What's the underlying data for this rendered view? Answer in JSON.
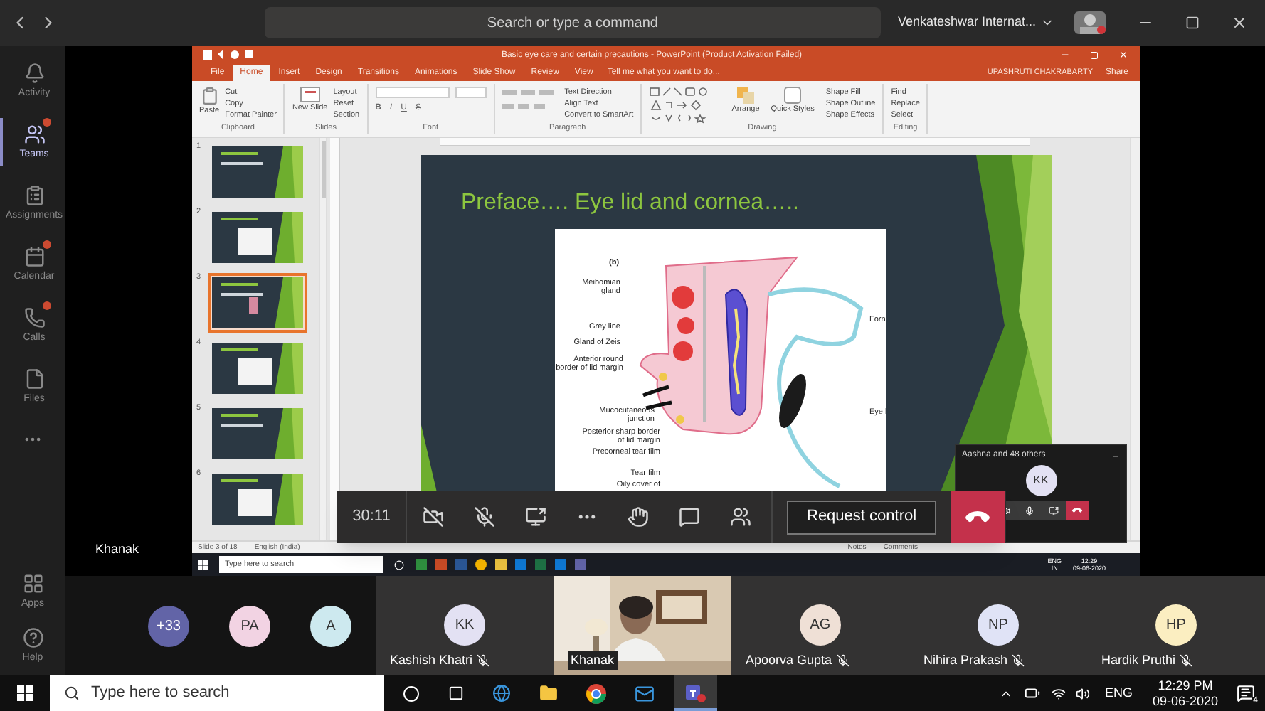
{
  "title_bar": {
    "search": {
      "placeholder": "Search or type a command"
    },
    "org": "Venkateshwar Internat..."
  },
  "app_bar": {
    "items": [
      {
        "kind": "activity",
        "label": "Activity",
        "selected": false,
        "dot": false
      },
      {
        "kind": "teams",
        "label": "Teams",
        "selected": true,
        "dot": true
      },
      {
        "kind": "assignments",
        "label": "Assignments",
        "selected": false,
        "dot": false
      },
      {
        "kind": "calendar",
        "label": "Calendar",
        "selected": false,
        "dot": true
      },
      {
        "kind": "calls",
        "label": "Calls",
        "selected": false,
        "dot": true
      },
      {
        "kind": "files",
        "label": "Files",
        "selected": false,
        "dot": false
      }
    ],
    "bottom": [
      {
        "kind": "apps",
        "label": "Apps"
      },
      {
        "kind": "help",
        "label": "Help"
      }
    ]
  },
  "shared_screen": {
    "title": "Basic eye care and certain precautions - PowerPoint (Product Activation Failed)",
    "tabs": [
      {
        "label": "File",
        "selected": false
      },
      {
        "label": "Home",
        "selected": true
      },
      {
        "label": "Insert",
        "selected": false
      },
      {
        "label": "Design",
        "selected": false
      },
      {
        "label": "Transitions",
        "selected": false
      },
      {
        "label": "Animations",
        "selected": false
      },
      {
        "label": "Slide Show",
        "selected": false
      },
      {
        "label": "Review",
        "selected": false
      },
      {
        "label": "View",
        "selected": false
      }
    ],
    "tell_me": "Tell me what you want to do...",
    "user": "UPASHRUTI CHAKRABARTY",
    "share": "Share",
    "ribbon_groups": [
      {
        "kind": "clipboard",
        "label": "Clipboard",
        "items": [
          "Paste",
          "Cut",
          "Copy",
          "Format Painter"
        ]
      },
      {
        "kind": "slides",
        "label": "Slides",
        "items": [
          "New Slide",
          "Layout",
          "Reset",
          "Section"
        ]
      },
      {
        "kind": "font",
        "label": "Font",
        "items": [
          "B",
          "I",
          "U",
          "S"
        ]
      },
      {
        "kind": "paragraph",
        "label": "Paragraph",
        "items": [
          "Text Direction",
          "Align Text",
          "Convert to SmartArt"
        ]
      },
      {
        "kind": "drawing",
        "label": "Drawing",
        "items": [
          "Arrange",
          "Quick Styles",
          "Shape Fill",
          "Shape Outline",
          "Shape Effects"
        ]
      },
      {
        "kind": "editing",
        "label": "Editing",
        "items": [
          "Find",
          "Replace",
          "Select"
        ]
      }
    ],
    "thumbnails": [
      {
        "number": "1",
        "selected": false
      },
      {
        "number": "2",
        "selected": false
      },
      {
        "number": "3",
        "selected": true
      },
      {
        "number": "4",
        "selected": false
      },
      {
        "number": "5",
        "selected": false
      },
      {
        "number": "6",
        "selected": false
      }
    ],
    "slide": {
      "title": "Preface…. Eye lid and cornea…..",
      "figure_labels": [
        {
          "text": "(b)"
        },
        {
          "text": "Meibomian gland"
        },
        {
          "text": "Grey line"
        },
        {
          "text": "Gland of Zeis"
        },
        {
          "text": "Anterior round border of lid margin"
        },
        {
          "text": "Mucocutaneous junction"
        },
        {
          "text": "Posterior sharp border of lid margin"
        },
        {
          "text": "Precorneal tear film"
        },
        {
          "text": "Tear film"
        },
        {
          "text": "Oily cover of"
        },
        {
          "text": "Forni"
        },
        {
          "text": "Eye l"
        }
      ]
    },
    "status": [
      "Slide 3 of 18",
      "English (India)"
    ],
    "status_right": [
      "Notes",
      "Comments"
    ],
    "inner_taskbar": {
      "search": {
        "placeholder": "Type here to search"
      },
      "language": "ENG",
      "region": "IN",
      "time": "12:29",
      "date": "09-06-2020"
    }
  },
  "presenter": "Khanak",
  "meeting_controls": {
    "timer": "30:11",
    "buttons": [
      {
        "kind": "camera_off"
      },
      {
        "kind": "mic_off"
      },
      {
        "kind": "share"
      },
      {
        "kind": "more"
      },
      {
        "kind": "hand"
      },
      {
        "kind": "chat"
      },
      {
        "kind": "people"
      }
    ],
    "request_control": "Request control"
  },
  "mini_window": {
    "title": "Aashna and 48 others",
    "avatar": "KK"
  },
  "gallery": {
    "overflow": "+33",
    "avatars": [
      {
        "initials": "PA",
        "color": "#f2d3e3"
      },
      {
        "initials": "A",
        "color": "#cde9ef"
      }
    ],
    "tiles": [
      {
        "kind": "avatar",
        "initials": "KK",
        "color": "#e3e1f3",
        "name": "Kashish Khatri",
        "muted": true
      },
      {
        "kind": "video",
        "name": "Khanak",
        "muted": false
      },
      {
        "kind": "avatar",
        "initials": "AG",
        "color": "#efe0d6",
        "name": "Apoorva Gupta",
        "muted": true
      },
      {
        "kind": "avatar",
        "initials": "NP",
        "color": "#e0e3f6",
        "name": "Nihira Prakash",
        "muted": true
      },
      {
        "kind": "avatar",
        "initials": "HP",
        "color": "#fbeec1",
        "name": "Hardik Pruthi",
        "muted": true
      }
    ]
  },
  "taskbar": {
    "search": {
      "placeholder": "Type here to search"
    },
    "language": "ENG",
    "time": "12:29 PM",
    "date": "09-06-2020",
    "notifications": "4"
  }
}
